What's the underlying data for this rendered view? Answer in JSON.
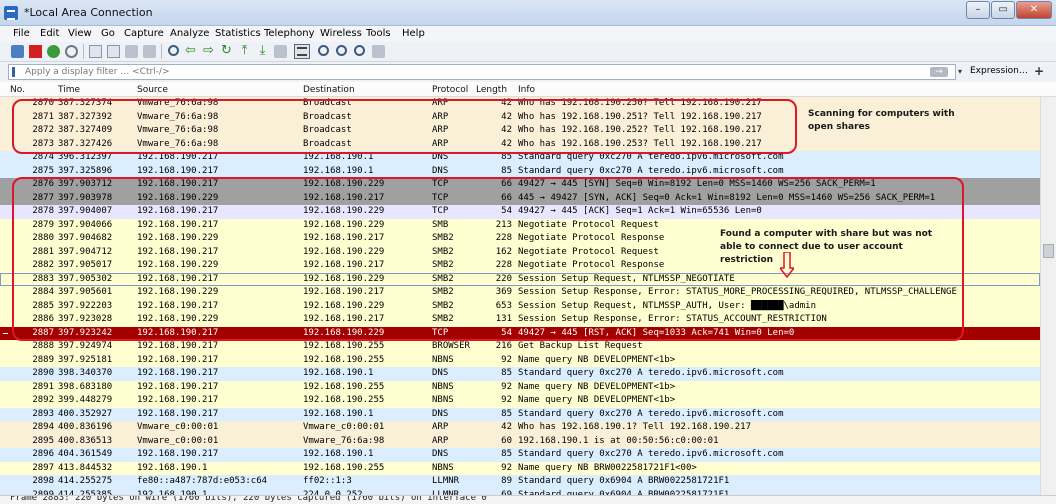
{
  "window": {
    "title": "*Local Area Connection",
    "buttons": {
      "minimize": "–",
      "maximize": "▭",
      "close": "✕"
    }
  },
  "menu": [
    "File",
    "Edit",
    "View",
    "Go",
    "Capture",
    "Analyze",
    "Statistics",
    "Telephony",
    "Wireless",
    "Tools",
    "Help"
  ],
  "toolbar_icons": [
    "shark-fin-icon",
    "stop-icon",
    "restart-icon",
    "options-icon",
    "open-file-icon",
    "save-file-icon",
    "close-file-icon",
    "reload-icon",
    "find-icon",
    "back-icon",
    "forward-icon",
    "goto-icon",
    "first-icon",
    "last-icon",
    "autoscroll-icon",
    "colorize-icon",
    "zoom-in-icon",
    "zoom-out-icon",
    "zoom-normal-icon",
    "resize-columns-icon"
  ],
  "filter": {
    "placeholder": "Apply a display filter … <Ctrl-/>",
    "apply": "→",
    "dropdown": "▾",
    "expression": "Expression…",
    "add": "+"
  },
  "columns": {
    "no": "No.",
    "time": "Time",
    "source": "Source",
    "destination": "Destination",
    "protocol": "Protocol",
    "length": "Length",
    "info": "Info"
  },
  "colors": {
    "arp": "#faf0d7",
    "dns": "#daeeff",
    "tcp": "#e7e6ff",
    "syn": "#a0a0a0",
    "smb": "#fefed0",
    "rst": "#a40000",
    "nbns": "#fefed0",
    "browser": "#fefed0",
    "llmnr": "#daeeff",
    "annotation": "#e0142a"
  },
  "packets": [
    {
      "no": "2870",
      "time": "387.327374",
      "src": "Vmware_76:6a:98",
      "dst": "Broadcast",
      "proto": "ARP",
      "len": "42",
      "info": "Who has 192.168.190.250? Tell 192.168.190.217",
      "cls": "arp"
    },
    {
      "no": "2871",
      "time": "387.327392",
      "src": "Vmware_76:6a:98",
      "dst": "Broadcast",
      "proto": "ARP",
      "len": "42",
      "info": "Who has 192.168.190.251? Tell 192.168.190.217",
      "cls": "arp"
    },
    {
      "no": "2872",
      "time": "387.327409",
      "src": "Vmware_76:6a:98",
      "dst": "Broadcast",
      "proto": "ARP",
      "len": "42",
      "info": "Who has 192.168.190.252? Tell 192.168.190.217",
      "cls": "arp"
    },
    {
      "no": "2873",
      "time": "387.327426",
      "src": "Vmware_76:6a:98",
      "dst": "Broadcast",
      "proto": "ARP",
      "len": "42",
      "info": "Who has 192.168.190.253? Tell 192.168.190.217",
      "cls": "arp"
    },
    {
      "no": "2874",
      "time": "396.312397",
      "src": "192.168.190.217",
      "dst": "192.168.190.1",
      "proto": "DNS",
      "len": "85",
      "info": "Standard query 0xc270 A teredo.ipv6.microsoft.com",
      "cls": "dns"
    },
    {
      "no": "2875",
      "time": "397.325896",
      "src": "192.168.190.217",
      "dst": "192.168.190.1",
      "proto": "DNS",
      "len": "85",
      "info": "Standard query 0xc270 A teredo.ipv6.microsoft.com",
      "cls": "dns"
    },
    {
      "no": "2876",
      "time": "397.903712",
      "src": "192.168.190.217",
      "dst": "192.168.190.229",
      "proto": "TCP",
      "len": "66",
      "info": "49427 → 445 [SYN] Seq=0 Win=8192 Len=0 MSS=1460 WS=256 SACK_PERM=1",
      "cls": "syn"
    },
    {
      "no": "2877",
      "time": "397.903978",
      "src": "192.168.190.229",
      "dst": "192.168.190.217",
      "proto": "TCP",
      "len": "66",
      "info": "445 → 49427 [SYN, ACK] Seq=0 Ack=1 Win=8192 Len=0 MSS=1460 WS=256 SACK_PERM=1",
      "cls": "syn"
    },
    {
      "no": "2878",
      "time": "397.904007",
      "src": "192.168.190.217",
      "dst": "192.168.190.229",
      "proto": "TCP",
      "len": "54",
      "info": "49427 → 445 [ACK] Seq=1 Ack=1 Win=65536 Len=0",
      "cls": "tcp"
    },
    {
      "no": "2879",
      "time": "397.904066",
      "src": "192.168.190.217",
      "dst": "192.168.190.229",
      "proto": "SMB",
      "len": "213",
      "info": "Negotiate Protocol Request",
      "cls": "smb"
    },
    {
      "no": "2880",
      "time": "397.904682",
      "src": "192.168.190.229",
      "dst": "192.168.190.217",
      "proto": "SMB2",
      "len": "228",
      "info": "Negotiate Protocol Response",
      "cls": "smb"
    },
    {
      "no": "2881",
      "time": "397.904712",
      "src": "192.168.190.217",
      "dst": "192.168.190.229",
      "proto": "SMB2",
      "len": "162",
      "info": "Negotiate Protocol Request",
      "cls": "smb"
    },
    {
      "no": "2882",
      "time": "397.905017",
      "src": "192.168.190.229",
      "dst": "192.168.190.217",
      "proto": "SMB2",
      "len": "228",
      "info": "Negotiate Protocol Response",
      "cls": "smb"
    },
    {
      "no": "2883",
      "time": "397.905302",
      "src": "192.168.190.217",
      "dst": "192.168.190.229",
      "proto": "SMB2",
      "len": "220",
      "info": "Session Setup Request, NTLMSSP_NEGOTIATE",
      "cls": "smb",
      "selected": true
    },
    {
      "no": "2884",
      "time": "397.905601",
      "src": "192.168.190.229",
      "dst": "192.168.190.217",
      "proto": "SMB2",
      "len": "369",
      "info": "Session Setup Response, Error: STATUS_MORE_PROCESSING_REQUIRED, NTLMSSP_CHALLENGE",
      "cls": "smb"
    },
    {
      "no": "2885",
      "time": "397.922203",
      "src": "192.168.190.217",
      "dst": "192.168.190.229",
      "proto": "SMB2",
      "len": "653",
      "info": "Session Setup Request, NTLMSSP_AUTH, User: ██████\\admin",
      "cls": "smb"
    },
    {
      "no": "2886",
      "time": "397.923028",
      "src": "192.168.190.229",
      "dst": "192.168.190.217",
      "proto": "SMB2",
      "len": "131",
      "info": "Session Setup Response, Error: STATUS_ACCOUNT_RESTRICTION",
      "cls": "smb"
    },
    {
      "no": "2887",
      "time": "397.923242",
      "src": "192.168.190.217",
      "dst": "192.168.190.229",
      "proto": "TCP",
      "len": "54",
      "info": "49427 → 445 [RST, ACK] Seq=1033 Ack=741 Win=0 Len=0",
      "cls": "rst"
    },
    {
      "no": "2888",
      "time": "397.924974",
      "src": "192.168.190.217",
      "dst": "192.168.190.255",
      "proto": "BROWSER",
      "len": "216",
      "info": "Get Backup List Request",
      "cls": "browser"
    },
    {
      "no": "2889",
      "time": "397.925181",
      "src": "192.168.190.217",
      "dst": "192.168.190.255",
      "proto": "NBNS",
      "len": "92",
      "info": "Name query NB DEVELOPMENT<1b>",
      "cls": "nbns"
    },
    {
      "no": "2890",
      "time": "398.340370",
      "src": "192.168.190.217",
      "dst": "192.168.190.1",
      "proto": "DNS",
      "len": "85",
      "info": "Standard query 0xc270 A teredo.ipv6.microsoft.com",
      "cls": "dns"
    },
    {
      "no": "2891",
      "time": "398.683180",
      "src": "192.168.190.217",
      "dst": "192.168.190.255",
      "proto": "NBNS",
      "len": "92",
      "info": "Name query NB DEVELOPMENT<1b>",
      "cls": "nbns"
    },
    {
      "no": "2892",
      "time": "399.448279",
      "src": "192.168.190.217",
      "dst": "192.168.190.255",
      "proto": "NBNS",
      "len": "92",
      "info": "Name query NB DEVELOPMENT<1b>",
      "cls": "nbns"
    },
    {
      "no": "2893",
      "time": "400.352927",
      "src": "192.168.190.217",
      "dst": "192.168.190.1",
      "proto": "DNS",
      "len": "85",
      "info": "Standard query 0xc270 A teredo.ipv6.microsoft.com",
      "cls": "dns"
    },
    {
      "no": "2894",
      "time": "400.836196",
      "src": "Vmware_c0:00:01",
      "dst": "Vmware_c0:00:01",
      "proto": "ARP",
      "len": "42",
      "info": "Who has 192.168.190.1? Tell 192.168.190.217",
      "cls": "arp"
    },
    {
      "no": "2895",
      "time": "400.836513",
      "src": "Vmware_c0:00:01",
      "dst": "Vmware_76:6a:98",
      "proto": "ARP",
      "len": "60",
      "info": "192.168.190.1 is at 00:50:56:c0:00:01",
      "cls": "arp"
    },
    {
      "no": "2896",
      "time": "404.361549",
      "src": "192.168.190.217",
      "dst": "192.168.190.1",
      "proto": "DNS",
      "len": "85",
      "info": "Standard query 0xc270 A teredo.ipv6.microsoft.com",
      "cls": "dns"
    },
    {
      "no": "2897",
      "time": "413.844532",
      "src": "192.168.190.1",
      "dst": "192.168.190.255",
      "proto": "NBNS",
      "len": "92",
      "info": "Name query NB BRW0022581721F1<00>",
      "cls": "nbns"
    },
    {
      "no": "2898",
      "time": "414.255275",
      "src": "fe80::a487:787d:e053:c64",
      "dst": "ff02::1:3",
      "proto": "LLMNR",
      "len": "89",
      "info": "Standard query 0x6904 A BRW0022581721F1",
      "cls": "llmnr"
    },
    {
      "no": "2899",
      "time": "414.255385",
      "src": "192.168.190.1",
      "dst": "224.0.0.252",
      "proto": "LLMNR",
      "len": "69",
      "info": "Standard query 0x6904 A BRW0022581721F1",
      "cls": "llmnr"
    }
  ],
  "annotations": {
    "scan": "Scanning for computers with open shares",
    "found": "Found a computer with share but was not able to connect due to user account restriction"
  },
  "status": "Frame 2883: 220 bytes on wire (1760 bits), 220 bytes captured (1760 bits) on interface 0"
}
